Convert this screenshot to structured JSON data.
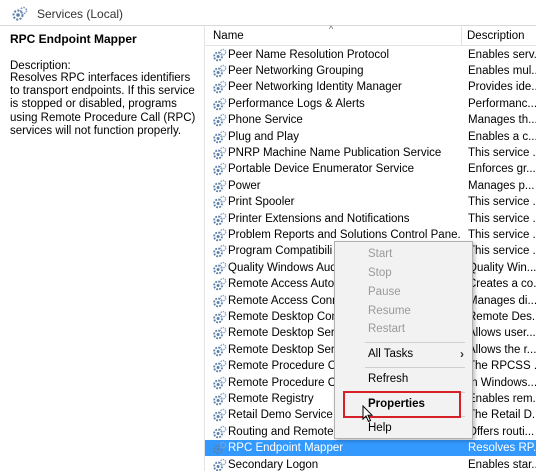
{
  "window": {
    "title": "Services (Local)"
  },
  "description_pane": {
    "service_name": "RPC Endpoint Mapper",
    "label": "Description:",
    "text": "Resolves RPC interfaces identifiers to transport endpoints. If this service is stopped or disabled, programs using Remote Procedure Call (RPC) services will not function properly."
  },
  "columns": {
    "name": "Name",
    "description": "Description"
  },
  "rows": [
    {
      "name": "Peer Name Resolution Protocol",
      "description": "Enables serv..."
    },
    {
      "name": "Peer Networking Grouping",
      "description": "Enables mul..."
    },
    {
      "name": "Peer Networking Identity Manager",
      "description": "Provides ide..."
    },
    {
      "name": "Performance Logs & Alerts",
      "description": "Performanc..."
    },
    {
      "name": "Phone Service",
      "description": "Manages th..."
    },
    {
      "name": "Plug and Play",
      "description": "Enables a c..."
    },
    {
      "name": "PNRP Machine Name Publication Service",
      "description": "This service ..."
    },
    {
      "name": "Portable Device Enumerator Service",
      "description": "Enforces gr..."
    },
    {
      "name": "Power",
      "description": "Manages p..."
    },
    {
      "name": "Print Spooler",
      "description": "This service ..."
    },
    {
      "name": "Printer Extensions and Notifications",
      "description": "This service ..."
    },
    {
      "name": "Problem Reports and Solutions Control Pane...",
      "description": "This service ..."
    },
    {
      "name": "Program Compatibili",
      "description": "This service ..."
    },
    {
      "name": "Quality Windows Aud",
      "description": "Quality Win..."
    },
    {
      "name": "Remote Access Auto",
      "description": "Creates a co..."
    },
    {
      "name": "Remote Access Conn",
      "description": "Manages di..."
    },
    {
      "name": "Remote Desktop Con",
      "description": "Remote Des..."
    },
    {
      "name": "Remote Desktop Serv",
      "description": "Allows user..."
    },
    {
      "name": "Remote Desktop Serv",
      "description": "Allows the r..."
    },
    {
      "name": "Remote Procedure Ca",
      "description": "The RPCSS ..."
    },
    {
      "name": "Remote Procedure Ca",
      "description": "In Windows..."
    },
    {
      "name": "Remote Registry",
      "description": "Enables rem..."
    },
    {
      "name": "Retail Demo Service",
      "description": "The Retail D..."
    },
    {
      "name": "Routing and Remote",
      "description": "Offers routi..."
    },
    {
      "name": "RPC Endpoint Mapper",
      "description": "Resolves RP..."
    },
    {
      "name": "Secondary Logon",
      "description": "Enables star..."
    }
  ],
  "context_menu": {
    "start": "Start",
    "stop": "Stop",
    "pause": "Pause",
    "resume": "Resume",
    "restart": "Restart",
    "all_tasks": "All Tasks",
    "refresh": "Refresh",
    "properties": "Properties",
    "help": "Help"
  },
  "colors": {
    "selection": "#3399ff",
    "highlight_box": "#d62027",
    "gear": "#5a7fa8"
  }
}
